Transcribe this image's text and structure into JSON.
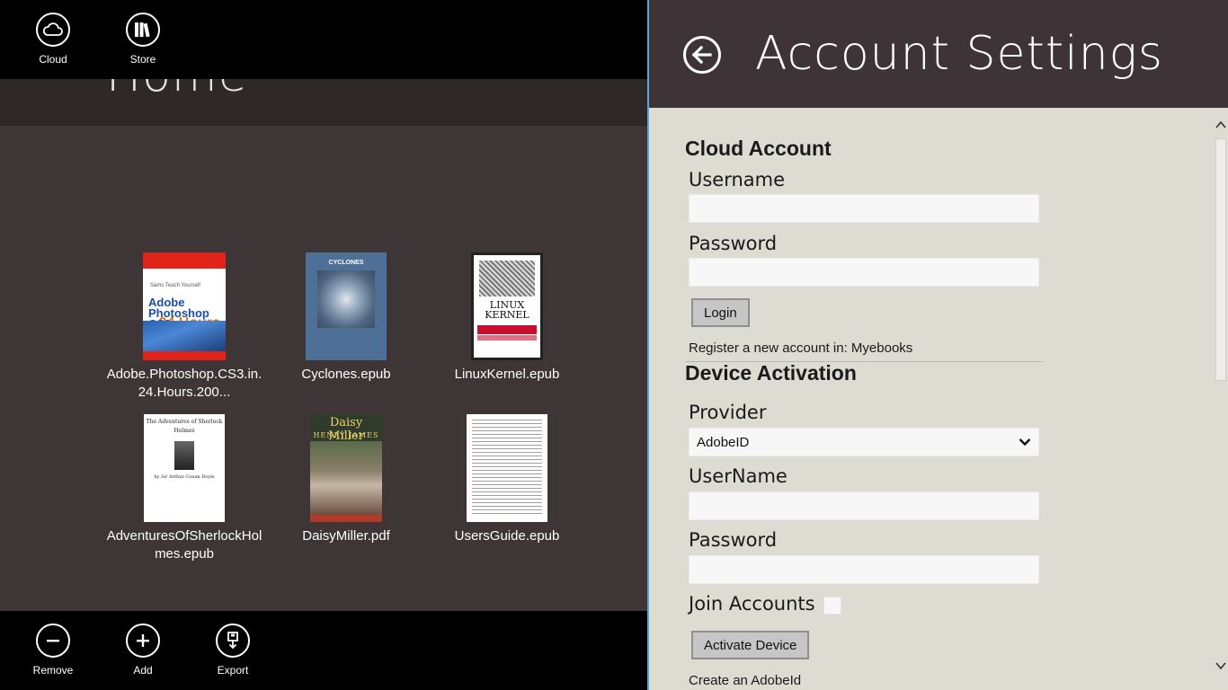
{
  "library": {
    "title": "Home",
    "top_appbar": {
      "cloud_label": "Cloud",
      "store_label": "Store"
    },
    "bottom_appbar": {
      "remove_label": "Remove",
      "add_label": "Add",
      "export_label": "Export"
    },
    "books": [
      {
        "name": "Adobe.Photoshop.CS3.in.24.Hours.200...",
        "cover": {
          "top_text": "Sams Teach Yourself",
          "title": "Adobe Photoshop CS3",
          "tag": "24 Hours"
        }
      },
      {
        "name": "Cyclones.epub",
        "cover": {
          "title": "CYCLONES"
        }
      },
      {
        "name": "LinuxKernel.epub",
        "cover": {
          "title": "LINUX KERNEL",
          "subtitle": "IN A NUTSHELL"
        }
      },
      {
        "name": "AdventuresOfSherlockHolmes.epub",
        "cover": {
          "title": "The Adventures of Sherlock Holmes",
          "author": "by Sir Arthur Conan Doyle"
        }
      },
      {
        "name": "DaisyMiller.pdf",
        "cover": {
          "title": "Daisy Miller",
          "author": "HENRY JAMES"
        }
      },
      {
        "name": "UsersGuide.epub",
        "cover": {}
      }
    ]
  },
  "settings": {
    "title": "Account Settings",
    "cloud_account": {
      "heading": "Cloud Account",
      "username_label": "Username",
      "username_value": "",
      "password_label": "Password",
      "password_value": "",
      "login_label": "Login",
      "register_text": "Register a new account in: Myebooks"
    },
    "device_activation": {
      "heading": "Device Activation",
      "provider_label": "Provider",
      "provider_selected": "AdobeID",
      "username_label": "UserName",
      "username_value": "",
      "password_label": "Password",
      "password_value": "",
      "join_label": "Join Accounts",
      "join_checked": false,
      "activate_label": "Activate Device",
      "create_text": "Create an AdobeId"
    }
  },
  "colors": {
    "accent_divider": "#5aa6d6",
    "header_bg": "#3e3337",
    "panel_bg": "#dcdcd3"
  }
}
